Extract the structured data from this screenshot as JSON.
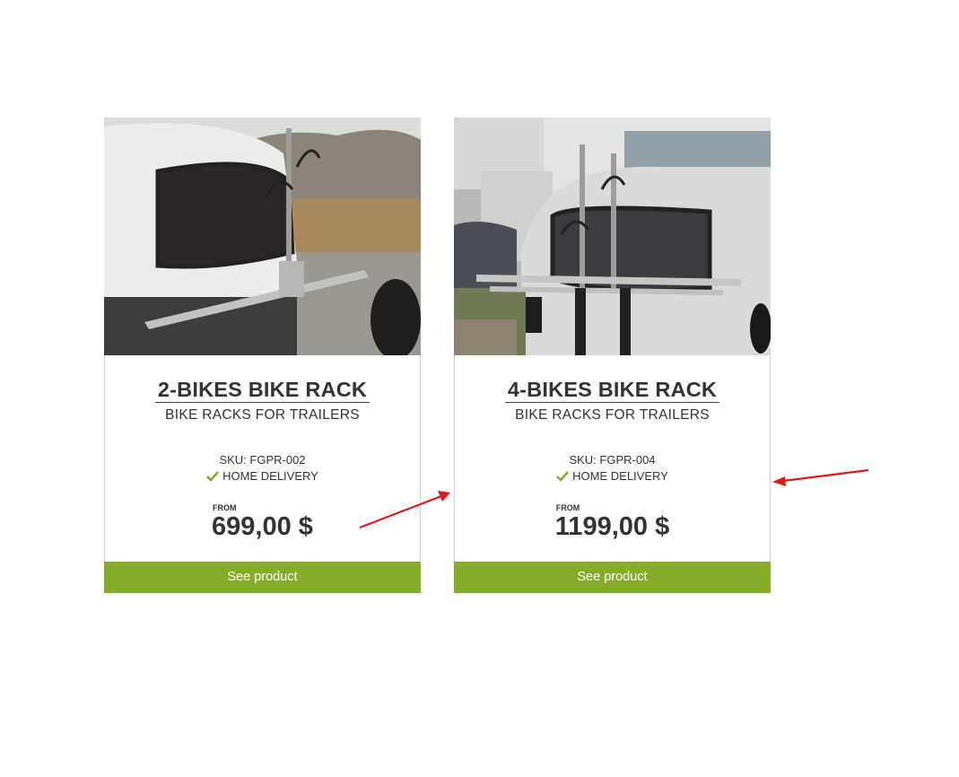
{
  "colors": {
    "accent_green": "#86ad2a",
    "annotation_red": "#e01818",
    "text": "#333333"
  },
  "products": [
    {
      "image_alt": "2-bikes rack mounted on teardrop trailer",
      "title": "2-BIKES BIKE RACK",
      "category": "BIKE RACKS FOR TRAILERS",
      "sku": "SKU: FGPR-002",
      "delivery": "HOME DELIVERY",
      "price_prefix": "FROM",
      "price": "699,00 $",
      "cta_label": "See product"
    },
    {
      "image_alt": "4-bikes rack mounted on teardrop trailer",
      "title": "4-BIKES BIKE RACK",
      "category": "BIKE RACKS FOR TRAILERS",
      "sku": "SKU: FGPR-004",
      "delivery": "HOME DELIVERY",
      "price_prefix": "FROM",
      "price": "1199,00 $",
      "cta_label": "See product"
    }
  ],
  "icons": {
    "delivery_icon": "checkmark-icon",
    "annotation": "red-arrow-icon"
  }
}
